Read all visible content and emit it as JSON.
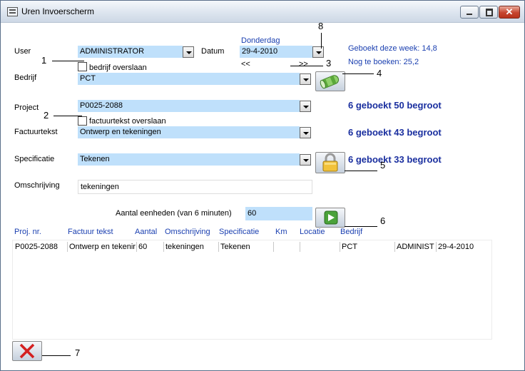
{
  "window": {
    "title": "Uren Invoerscherm"
  },
  "form": {
    "user_label": "User",
    "user_value": "ADMINISTRATOR",
    "datum_label": "Datum",
    "day_label": "Donderdag",
    "datum_value": "29-4-2010",
    "prev_label": "<<",
    "next_label": ">>",
    "geboekt_week": "Geboekt deze week: 14,8",
    "nog_te_boeken": "Nog te boeken: 25,2",
    "bedrijf_skip_label": "bedrijf overslaan",
    "bedrijf_label": "Bedrijf",
    "bedrijf_value": "PCT",
    "project_label": "Project",
    "project_value": "P0025-2088",
    "project_stat": "6 geboekt 50 begroot",
    "factuur_skip_label": "factuurtekst overslaan",
    "factuurtekst_label": "Factuurtekst",
    "factuurtekst_value": "Ontwerp en tekeningen",
    "factuur_stat": "6 geboekt 43 begroot",
    "specificatie_label": "Specificatie",
    "specificatie_value": "Tekenen",
    "specificatie_stat": "6 geboekt 33 begroot",
    "omschrijving_label": "Omschrijving",
    "omschrijving_value": "tekeningen",
    "aantal_label": "Aantal eenheden (van 6 minuten)",
    "aantal_value": "60"
  },
  "callouts": [
    "1",
    "2",
    "3",
    "4",
    "5",
    "6",
    "7",
    "8"
  ],
  "table": {
    "headers": [
      "Proj. nr.",
      "Factuur tekst",
      "Aantal",
      "Omschrijving",
      "Specificatie",
      "Km",
      "Locatie",
      "Bedrijf"
    ],
    "rows": [
      [
        "P0025-2088",
        "Ontwerp en tekenir",
        "60",
        "tekeningen",
        "Tekenen",
        "",
        "",
        "PCT",
        "ADMINIST",
        "29-4-2010"
      ]
    ]
  },
  "icons": {
    "title": "form-icon",
    "money": "money-icon",
    "lock": "padlock-icon",
    "go": "play-icon",
    "cancel": "red-x-icon"
  },
  "colors": {
    "field_bg": "#bfe0fb",
    "label_blue": "#1a3fb0",
    "stat_blue": "#1a2f9f",
    "close_red": "#c6452e"
  }
}
